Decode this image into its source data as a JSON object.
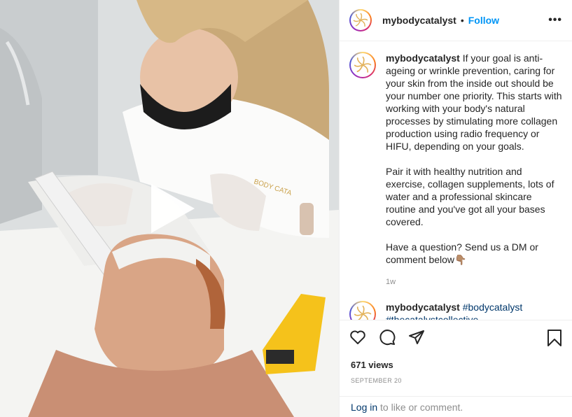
{
  "header": {
    "username": "mybodycatalyst",
    "separator": "•",
    "follow_label": "Follow",
    "more_label": "•••"
  },
  "caption": {
    "username": "mybodycatalyst",
    "para1": "If your goal is anti-ageing or wrinkle prevention, caring for your skin from the inside out should be your number one priority. This starts with working with your body's natural processes by stimulating more collagen production using radio frequency or HIFU, depending on your goals.",
    "para2": "Pair it with healthy nutrition and exercise, collagen supplements, lots of water and a professional skincare routine and you've got all your bases covered.",
    "para3": "Have a question? Send us a DM or comment below👇🏽",
    "time": "1w"
  },
  "comment2": {
    "username": "mybodycatalyst",
    "tag1": "#bodycatalyst",
    "tag2": "#thecatalystcollective"
  },
  "media": {
    "shirt_logo_text": "BODY CATA"
  },
  "actions": {
    "views": "671 views",
    "date": "SEPTEMBER 20"
  },
  "footer": {
    "login_link": "Log in",
    "login_rest": " to like or comment."
  },
  "colors": {
    "follow": "#0095f6",
    "hashtag": "#00376b",
    "muted": "#8e8e8e"
  }
}
